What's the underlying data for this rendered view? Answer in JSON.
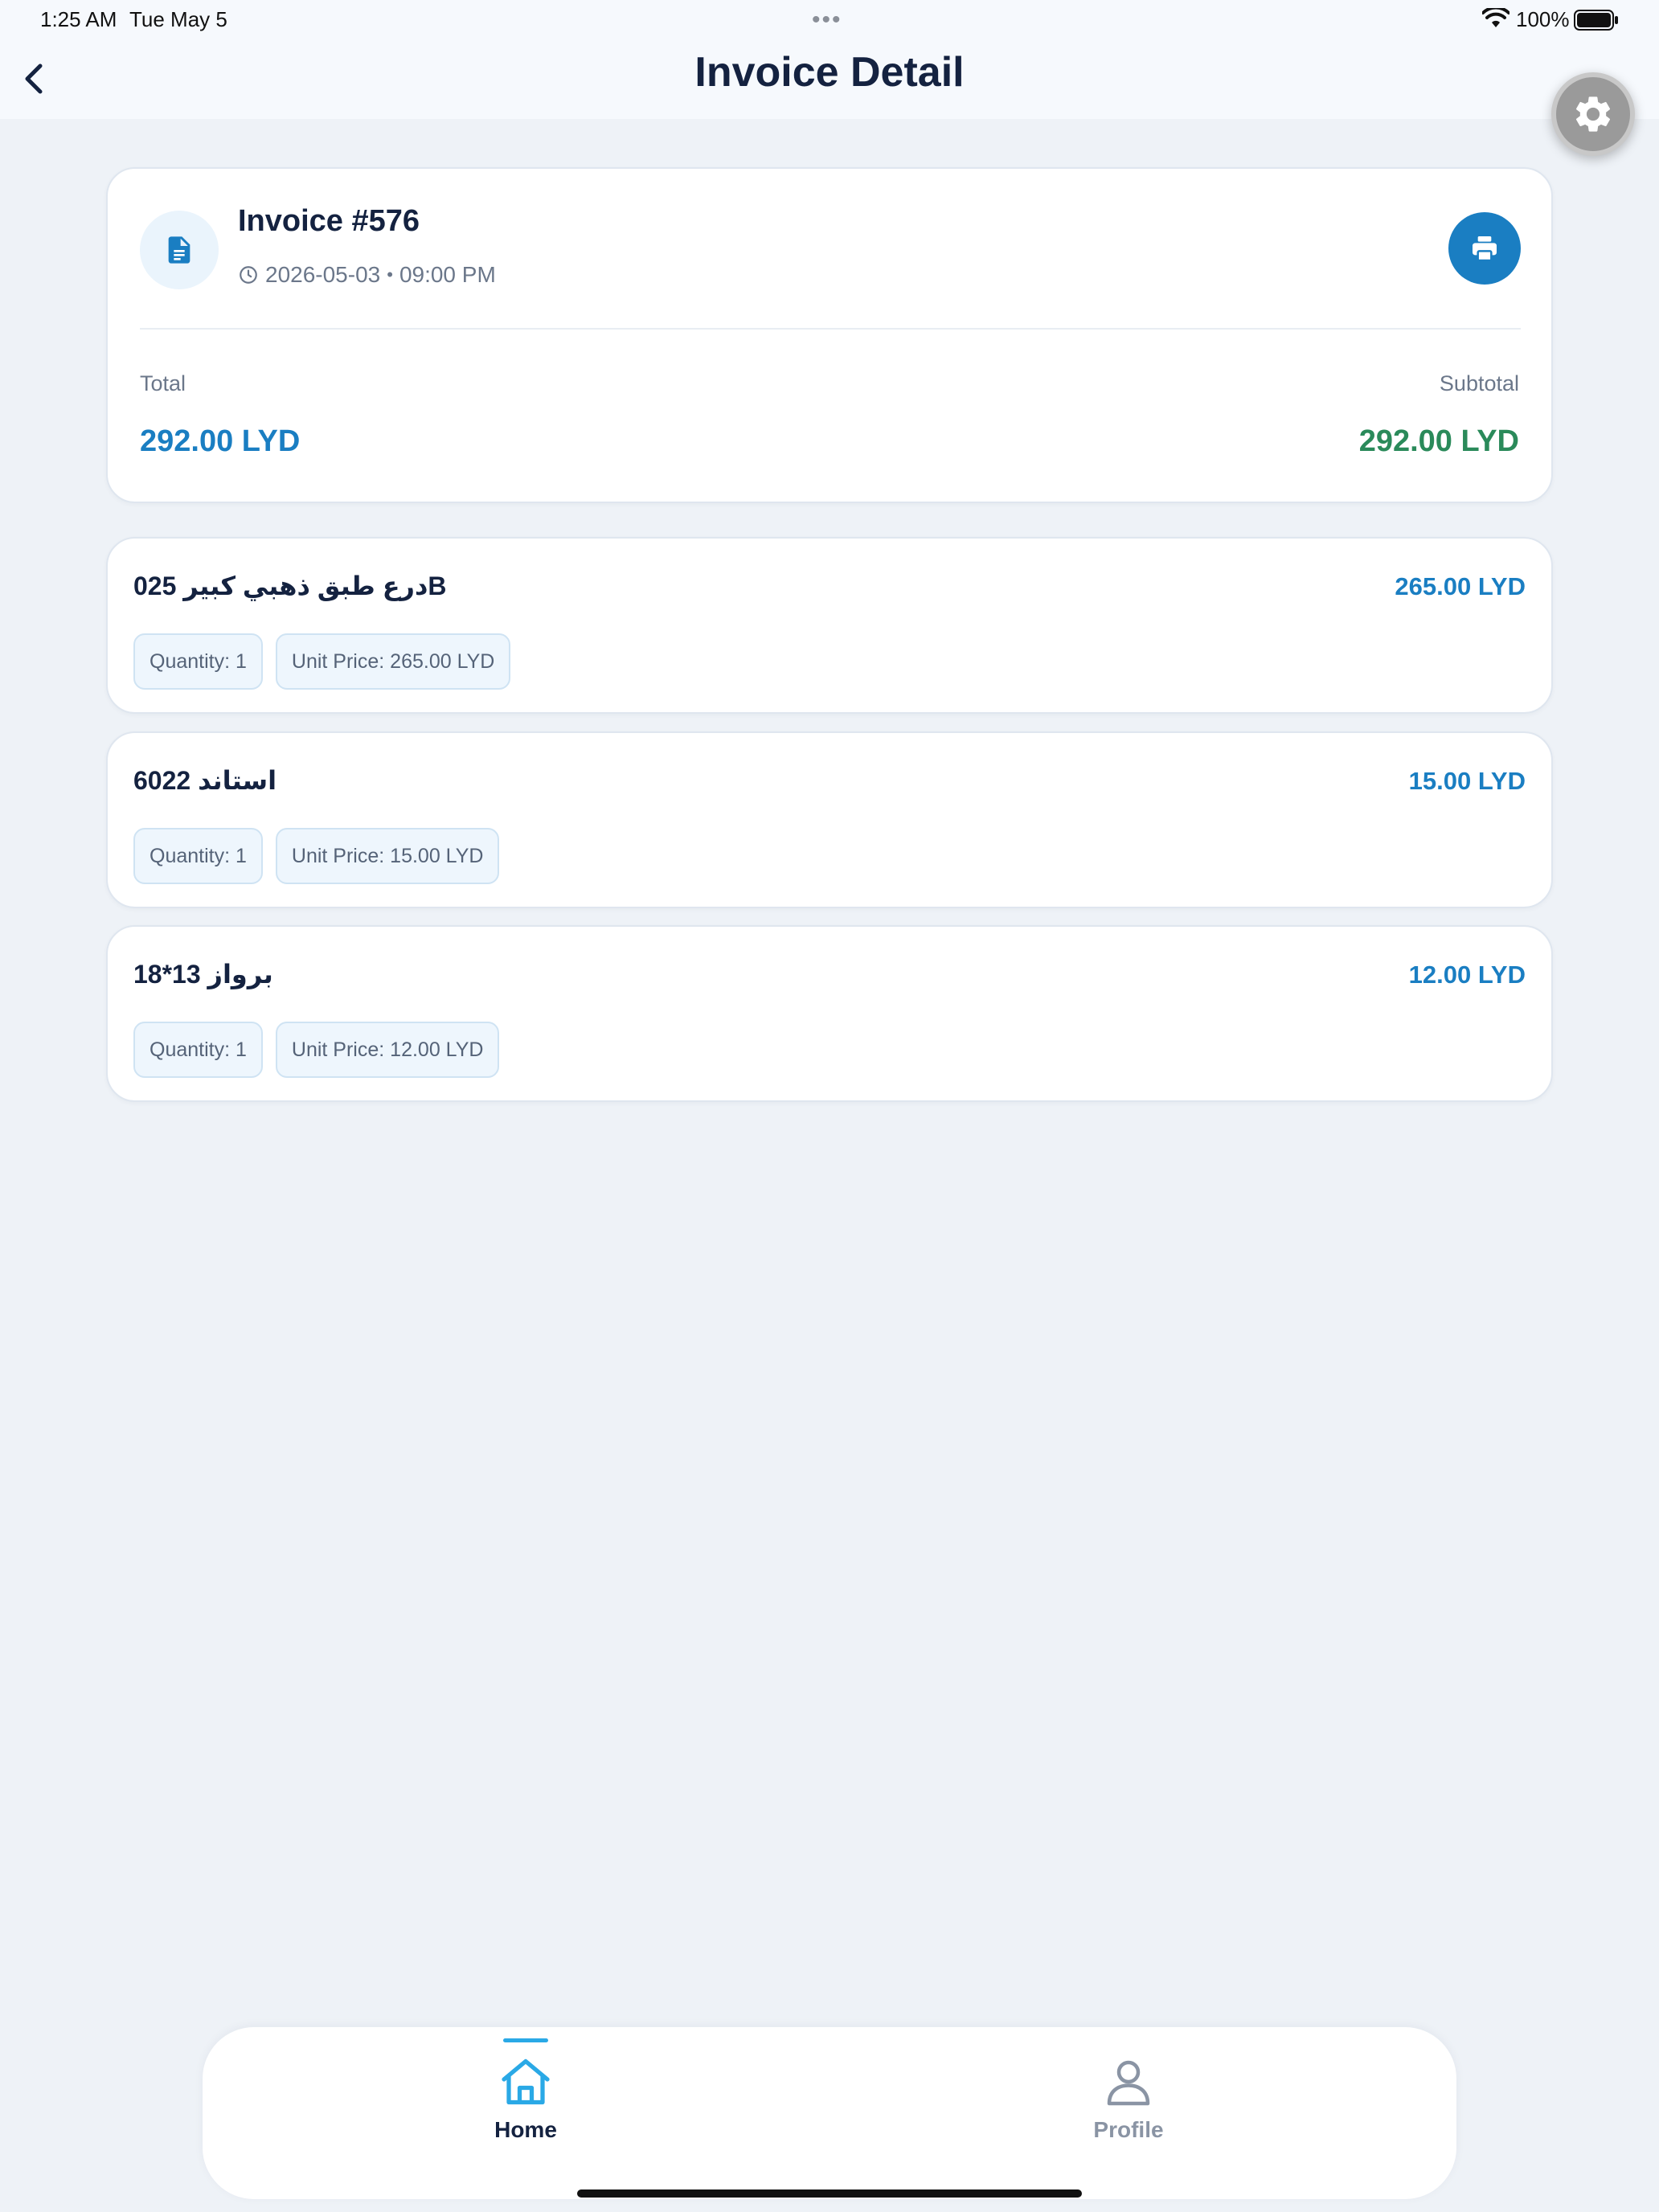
{
  "status_bar": {
    "time": "1:25 AM",
    "date": "Tue May 5",
    "battery_percent": "100%",
    "dots": "•••"
  },
  "nav": {
    "title": "Invoice Detail",
    "back_icon": "chevron-left-icon",
    "settings_icon": "gear-icon"
  },
  "invoice": {
    "title": "Invoice #576",
    "date": "2026-05-03",
    "separator": "•",
    "time": "09:00 PM",
    "total_label": "Total",
    "total_value": "292.00 LYD",
    "subtotal_label": "Subtotal",
    "subtotal_value": "292.00 LYD",
    "icon": "document-icon",
    "print_icon": "printer-icon"
  },
  "items": [
    {
      "name": "درع طبق ذهبي كبير 025B",
      "total": "265.00 LYD",
      "quantity": "Quantity: 1",
      "unit_price": "Unit Price: 265.00 LYD"
    },
    {
      "name": "استاند 6022",
      "total": "15.00 LYD",
      "quantity": "Quantity: 1",
      "unit_price": "Unit Price: 15.00 LYD"
    },
    {
      "name": "برواز 13*18",
      "total": "12.00 LYD",
      "quantity": "Quantity: 1",
      "unit_price": "Unit Price: 12.00 LYD"
    }
  ],
  "tabs": [
    {
      "label": "Home",
      "icon": "home-icon",
      "active": true
    },
    {
      "label": "Profile",
      "icon": "user-icon",
      "active": false
    }
  ],
  "colors": {
    "primary": "#1a7ec2",
    "success": "#2a8a5a",
    "text": "#142240",
    "background": "#eef2f7"
  }
}
